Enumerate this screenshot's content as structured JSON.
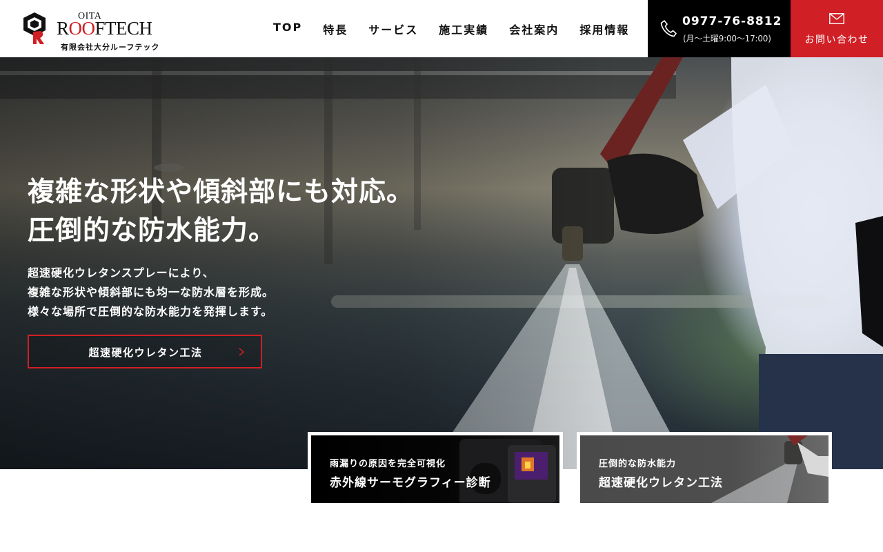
{
  "brand": {
    "oita": "OITA",
    "name_left": "R",
    "name_red": "OO",
    "name_right": "FTECH",
    "subtitle": "有限会社大分ルーフテック",
    "accent_color": "#d01f25"
  },
  "nav": {
    "items": [
      {
        "label": "TOP"
      },
      {
        "label": "特長"
      },
      {
        "label": "サービス"
      },
      {
        "label": "施工実績"
      },
      {
        "label": "会社案内"
      },
      {
        "label": "採用情報"
      }
    ]
  },
  "phone": {
    "icon": "phone-icon",
    "number": "0977-76-8812",
    "hours": "(月〜土曜9:00〜17:00)"
  },
  "contact": {
    "icon": "mail-icon",
    "label": "お問い合わせ"
  },
  "hero": {
    "title_line1": "複雑な形状や傾斜部にも対応。",
    "title_line2": "圧倒的な防水能力。",
    "text_line1": "超速硬化ウレタンスプレーにより、",
    "text_line2": "複雑な形状や傾斜部にも均一な防水層を形成。",
    "text_line3": "様々な場所で圧倒的な防水能力を発揮します。",
    "button_label": "超速硬化ウレタン工法",
    "button_icon": "chevron-right-icon"
  },
  "cards": [
    {
      "small": "雨漏りの原因を完全可視化",
      "large": "赤外線サーモグラフィー診断"
    },
    {
      "small": "圧倒的な防水能力",
      "large": "超速硬化ウレタン工法"
    }
  ]
}
